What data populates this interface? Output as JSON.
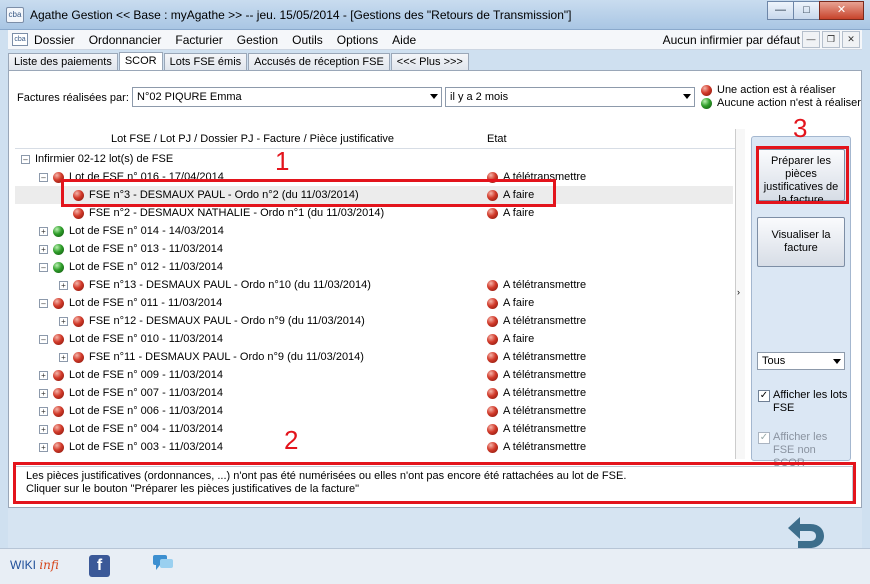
{
  "window": {
    "title": "Agathe Gestion << Base : myAgathe >>   --   jeu. 15/05/2014  -  [Gestions des \"Retours de Transmission\"]",
    "icon_text": "cba"
  },
  "menu": {
    "icon_text": "cba",
    "items": [
      "Dossier",
      "Ordonnancier",
      "Facturier",
      "Gestion",
      "Outils",
      "Options",
      "Aide"
    ],
    "right_text": "Aucun infirmier par défaut"
  },
  "tabs": [
    "Liste des paiements",
    "SCOR",
    "Lots FSE émis",
    "Accusés de réception FSE",
    "<<< Plus >>>"
  ],
  "filter": {
    "label": "Factures réalisées par:",
    "nurse": "N°02  PIQURE Emma",
    "period": "il y a 2 mois"
  },
  "legend": {
    "red": "Une action est à réaliser",
    "green": "Aucune action n'est à réaliser"
  },
  "grid": {
    "col1": "Lot FSE / Lot PJ / Dossier PJ - Facture / Pièce justificative",
    "col2": "Etat",
    "rows": [
      {
        "label": "Infirmier 02-12 lot(s) de FSE",
        "state": ""
      },
      {
        "label": "Lot de FSE n° 016 - 17/04/2014",
        "state": "A télétransmettre"
      },
      {
        "label": "FSE n°3 - DESMAUX PAUL - Ordo n°2 (du 11/03/2014)",
        "state": "A faire"
      },
      {
        "label": "FSE n°2 - DESMAUX NATHALIE - Ordo n°1 (du 11/03/2014)",
        "state": "A faire"
      },
      {
        "label": "Lot de FSE n° 014 - 14/03/2014",
        "state": ""
      },
      {
        "label": "Lot de FSE n° 013 - 11/03/2014",
        "state": ""
      },
      {
        "label": "Lot de FSE n° 012 - 11/03/2014",
        "state": ""
      },
      {
        "label": "FSE n°13 - DESMAUX PAUL - Ordo n°10 (du 11/03/2014)",
        "state": "A télétransmettre"
      },
      {
        "label": "Lot de FSE n° 011 - 11/03/2014",
        "state": "A faire"
      },
      {
        "label": "FSE n°12 - DESMAUX PAUL - Ordo n°9 (du 11/03/2014)",
        "state": "A télétransmettre"
      },
      {
        "label": "Lot de FSE n° 010 - 11/03/2014",
        "state": "A faire"
      },
      {
        "label": "FSE n°11 - DESMAUX PAUL - Ordo n°9 (du 11/03/2014)",
        "state": "A télétransmettre"
      },
      {
        "label": "Lot de FSE n° 009 - 11/03/2014",
        "state": "A télétransmettre"
      },
      {
        "label": "Lot de FSE n° 007 - 11/03/2014",
        "state": "A télétransmettre"
      },
      {
        "label": "Lot de FSE n° 006 - 11/03/2014",
        "state": "A télétransmettre"
      },
      {
        "label": "Lot de FSE n° 004 - 11/03/2014",
        "state": "A télétransmettre"
      },
      {
        "label": "Lot de FSE n° 003 - 11/03/2014",
        "state": "A télétransmettre"
      }
    ]
  },
  "side": {
    "btn_prepare": "Préparer les pièces justificatives de la facture",
    "btn_view": "Visualiser la facture",
    "filter_value": "Tous",
    "chk_lots": "Afficher les lots FSE",
    "chk_non_scor": "Afficher les FSE non SCOR"
  },
  "message": {
    "line1": "Les pièces justificatives (ordonnances, ...) n'ont pas été numérisées ou elles n'ont pas encore été rattachées au lot de FSE.",
    "line2": "Cliquer sur le bouton \"Préparer les pièces justificatives de la facture\""
  },
  "annotations": {
    "a1": "1",
    "a2": "2",
    "a3": "3"
  },
  "footer": {
    "wiki": "WIKI",
    "infi": "infi",
    "fb": "f"
  },
  "colors": {
    "annotation_red": "#e3141c",
    "status_red": "#d23a2a",
    "status_green": "#2f9e2a"
  }
}
